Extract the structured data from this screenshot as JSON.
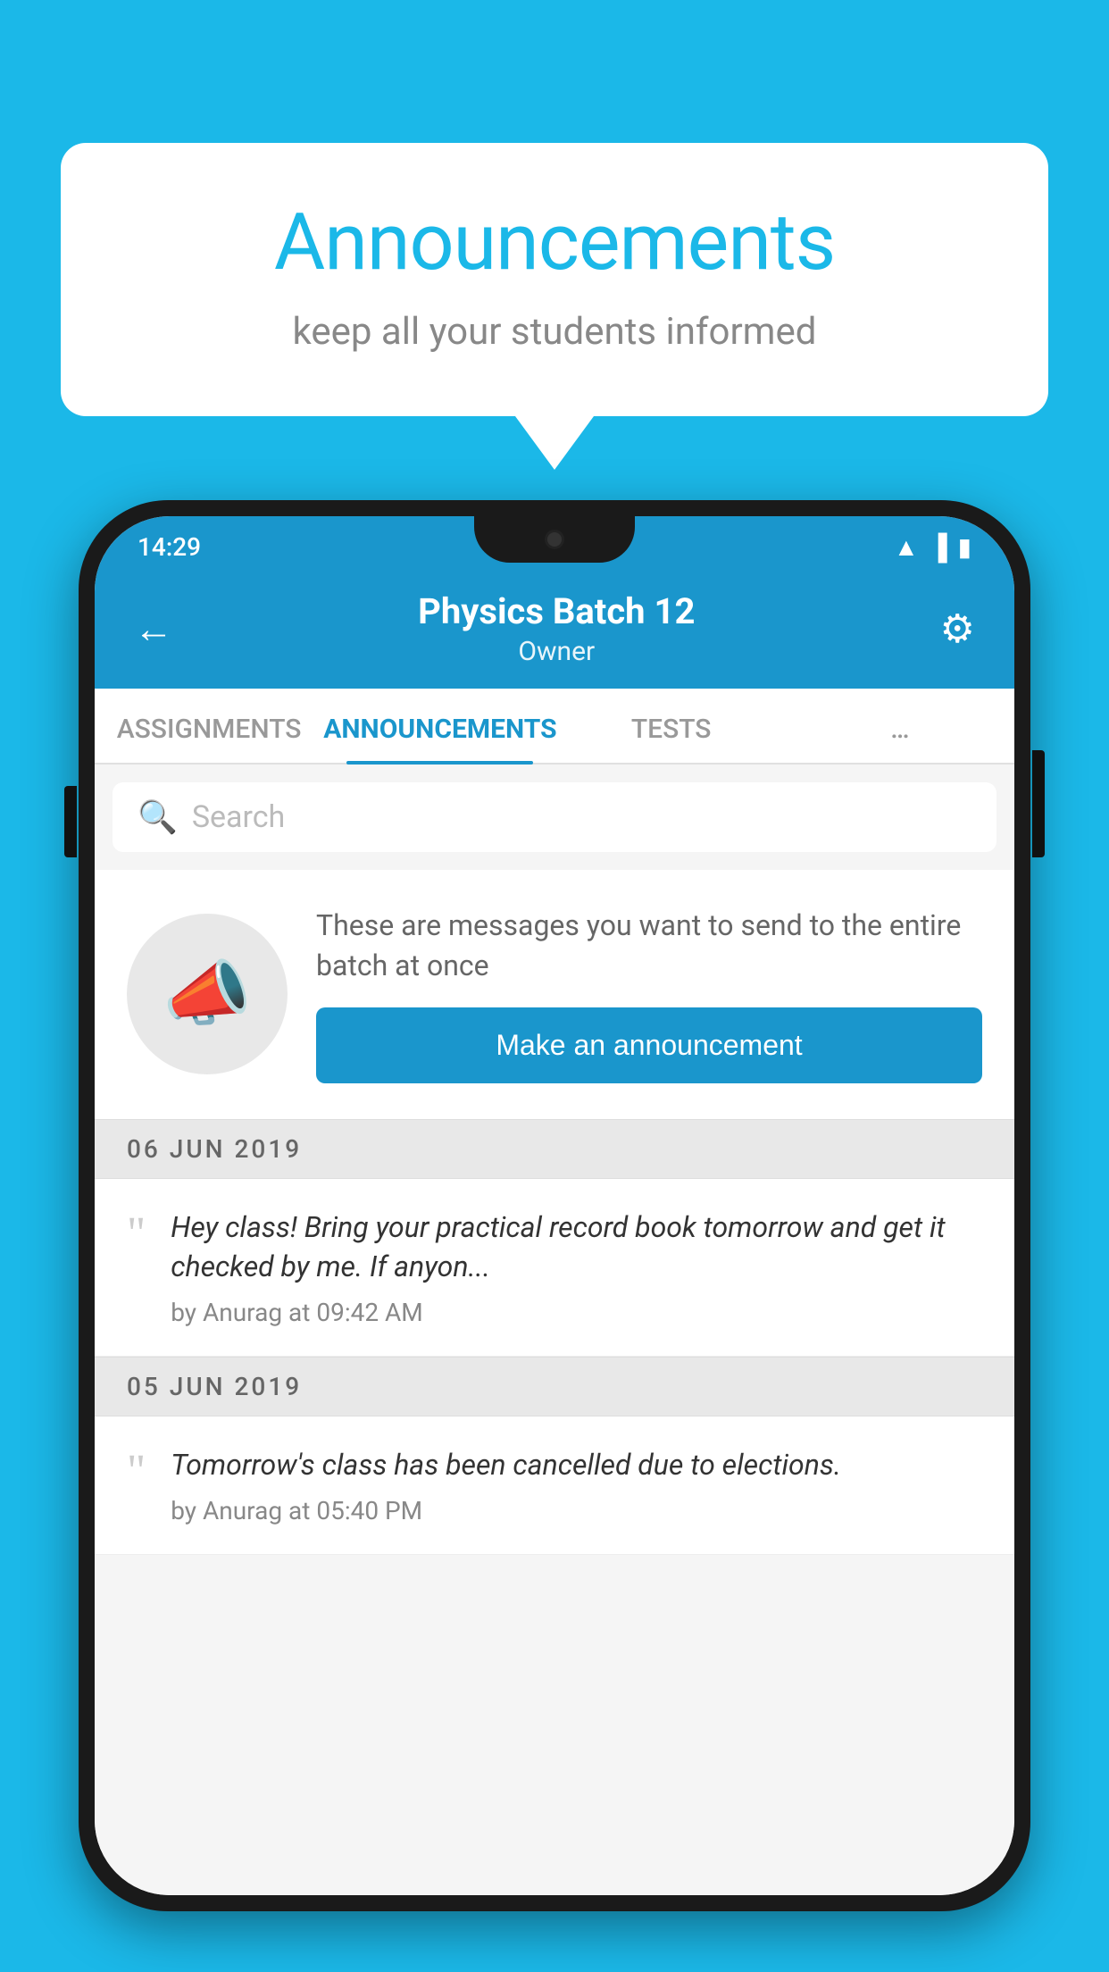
{
  "background_color": "#1bb8e8",
  "speech_bubble": {
    "title": "Announcements",
    "subtitle": "keep all your students informed"
  },
  "status_bar": {
    "time": "14:29",
    "icons": [
      "wifi",
      "signal",
      "battery"
    ]
  },
  "app_header": {
    "title": "Physics Batch 12",
    "subtitle": "Owner",
    "back_label": "←",
    "gear_label": "⚙"
  },
  "tabs": [
    {
      "label": "ASSIGNMENTS",
      "active": false
    },
    {
      "label": "ANNOUNCEMENTS",
      "active": true
    },
    {
      "label": "TESTS",
      "active": false
    },
    {
      "label": "…",
      "active": false
    }
  ],
  "search": {
    "placeholder": "Search"
  },
  "announcement_prompt": {
    "description": "These are messages you want to send to the entire batch at once",
    "button_label": "Make an announcement"
  },
  "announcements": [
    {
      "date": "06  JUN  2019",
      "text": "Hey class! Bring your practical record book tomorrow and get it checked by me. If anyon...",
      "meta": "by Anurag at 09:42 AM"
    },
    {
      "date": "05  JUN  2019",
      "text": "Tomorrow's class has been cancelled due to elections.",
      "meta": "by Anurag at 05:40 PM"
    }
  ]
}
